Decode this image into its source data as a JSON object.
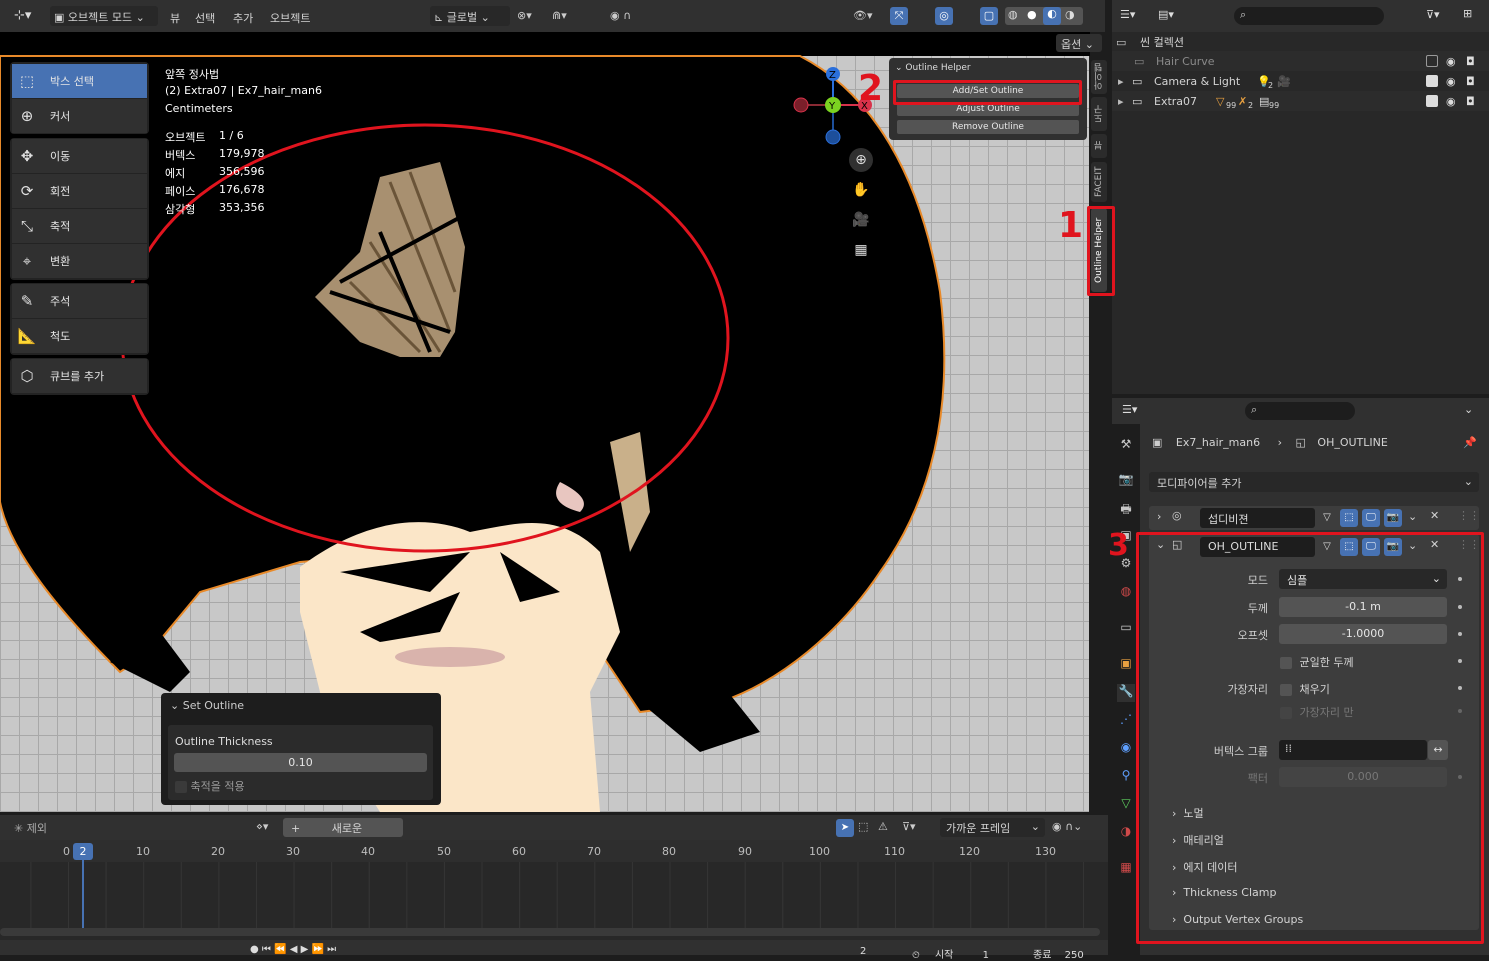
{
  "header": {
    "mode": "오브젝트 모드",
    "menu": [
      "뷰",
      "선택",
      "추가",
      "오브젝트"
    ],
    "transform_orientation": "글로벌",
    "options": "옵션"
  },
  "tools": [
    {
      "label": "박스 선택",
      "icon": "box-select-icon",
      "glyph": "⬚"
    },
    {
      "label": "커서",
      "icon": "cursor-icon",
      "glyph": "⊕"
    },
    {
      "label": "이동",
      "icon": "move-icon",
      "glyph": "✥"
    },
    {
      "label": "회전",
      "icon": "rotate-icon",
      "glyph": "⟳"
    },
    {
      "label": "축적",
      "icon": "scale-icon",
      "glyph": "⤡"
    },
    {
      "label": "변환",
      "icon": "transform-icon",
      "glyph": "⌖"
    },
    {
      "label": "주석",
      "icon": "annotate-icon",
      "glyph": "✎"
    },
    {
      "label": "척도",
      "icon": "measure-icon",
      "glyph": "📐"
    },
    {
      "label": "큐브를 추가",
      "icon": "add-cube-icon",
      "glyph": "⬡"
    }
  ],
  "viewport_info": {
    "view": "앞쪽 정사법",
    "object": "(2) Extra07 | Ex7_hair_man6",
    "units": "Centimeters",
    "stats": [
      {
        "key": "오브젝트",
        "value": "1 / 6"
      },
      {
        "key": "버텍스",
        "value": "179,978"
      },
      {
        "key": "에지",
        "value": "356,596"
      },
      {
        "key": "페이스",
        "value": "176,678"
      },
      {
        "key": "삼각형",
        "value": "353,356"
      }
    ]
  },
  "outline_helper": {
    "title": "Outline Helper",
    "buttons": [
      "Add/Set Outline",
      "Adjust Outline",
      "Remove Outline"
    ]
  },
  "side_tabs": [
    "아이템",
    "도구",
    "뷰",
    "FACEIT",
    "Outline Helper"
  ],
  "gizmo": {
    "z": "Z",
    "y": "Y",
    "x": "X"
  },
  "set_outline": {
    "title": "Set Outline",
    "label": "Outline Thickness",
    "value": "0.10",
    "checkbox": "축적을 적용"
  },
  "annotations": [
    "1",
    "2",
    "3"
  ],
  "outliner": {
    "root": "씬 컬렉션",
    "items": [
      {
        "name": "Hair Curve",
        "muted": true
      },
      {
        "name": "Camera & Light",
        "badge": "2"
      },
      {
        "name": "Extra07",
        "badge1": "99",
        "badge2": "2",
        "badge3": "99"
      }
    ]
  },
  "properties": {
    "breadcrumb_object": "Ex7_hair_man6",
    "breadcrumb_modifier": "OH_OUTLINE",
    "add_modifier": "모디파이어를 추가",
    "modifiers": [
      {
        "name": "섭디비젼"
      },
      {
        "name": "OH_OUTLINE"
      }
    ],
    "fields": {
      "mode_label": "모드",
      "mode_value": "심플",
      "thickness_label": "두께",
      "thickness_value": "-0.1 m",
      "offset_label": "오프셋",
      "offset_value": "-1.0000",
      "even_label": "균일한 두께",
      "rim_label": "가장자리",
      "fill_label": "채우기",
      "rim_only_label": "가장자리 만",
      "vgroup_label": "버텍스 그룹",
      "factor_label": "팩터",
      "factor_value": "0.000"
    },
    "subpanels": [
      "노멀",
      "매테리얼",
      "에지 데이터",
      "Thickness Clamp",
      "Output Vertex Groups"
    ]
  },
  "timeline": {
    "exclude": "제외",
    "new": "새로운",
    "snap": "가까운 프레임",
    "current_frame": "2",
    "start_marker": "0",
    "ticks": [
      "10",
      "20",
      "30",
      "40",
      "50",
      "60",
      "70",
      "80",
      "90",
      "100",
      "110",
      "120",
      "130"
    ],
    "bottom": {
      "frame": "2",
      "start_label": "시작",
      "start": "1",
      "end_label": "종료",
      "end": "250"
    }
  },
  "colors": {
    "accent": "#4772b3",
    "annotation": "#e0141e",
    "viewport_bg": "#c8c8c8",
    "skin": "#fbe6c8",
    "hair": "#000000"
  }
}
